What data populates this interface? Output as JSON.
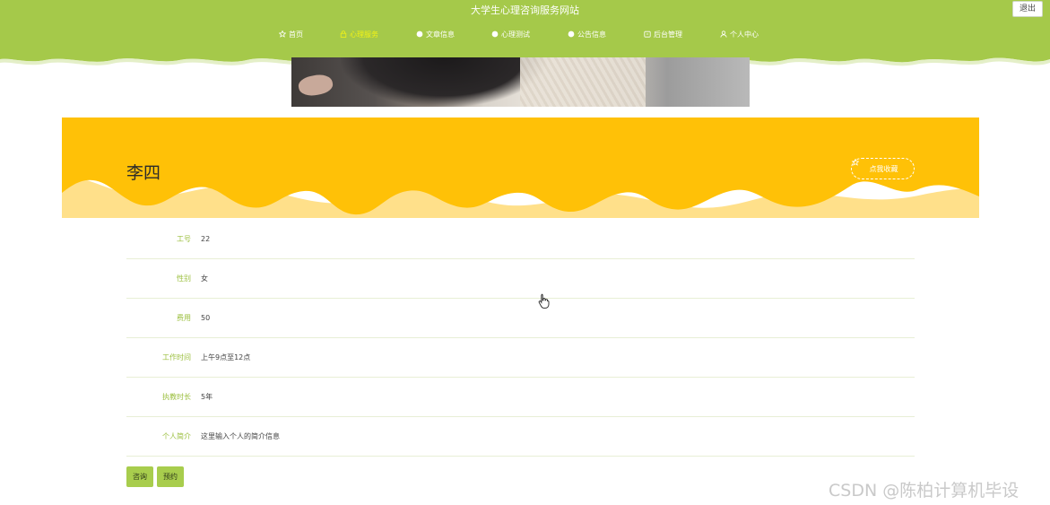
{
  "header": {
    "site_title": "大学生心理咨询服务网站",
    "logout_label": "退出",
    "bg_color": "#a5c94a",
    "active_color": "#f3f315"
  },
  "nav": {
    "items": [
      {
        "label": "首页",
        "icon": "star-icon"
      },
      {
        "label": "心理服务",
        "icon": "lock-icon",
        "active": true
      },
      {
        "label": "文章信息",
        "icon": "dot-icon"
      },
      {
        "label": "心理测试",
        "icon": "dot-icon"
      },
      {
        "label": "公告信息",
        "icon": "dot-icon"
      },
      {
        "label": "后台管理",
        "icon": "box-icon"
      },
      {
        "label": "个人中心",
        "icon": "user-icon"
      }
    ]
  },
  "hero": {
    "name": "李四",
    "favorite_label": "点我收藏",
    "bg_color": "#ffc107"
  },
  "details": {
    "rows": [
      {
        "label": "工号",
        "value": "22"
      },
      {
        "label": "性别",
        "value": "女"
      },
      {
        "label": "费用",
        "value": "50"
      },
      {
        "label": "工作时间",
        "value": "上午9点至12点"
      },
      {
        "label": "执教时长",
        "value": "5年"
      },
      {
        "label": "个人简介",
        "value": "这里输入个人的简介信息"
      }
    ]
  },
  "actions": {
    "consult_label": "咨询",
    "reserve_label": "预约"
  },
  "watermark": "CSDN @陈柏计算机毕设"
}
